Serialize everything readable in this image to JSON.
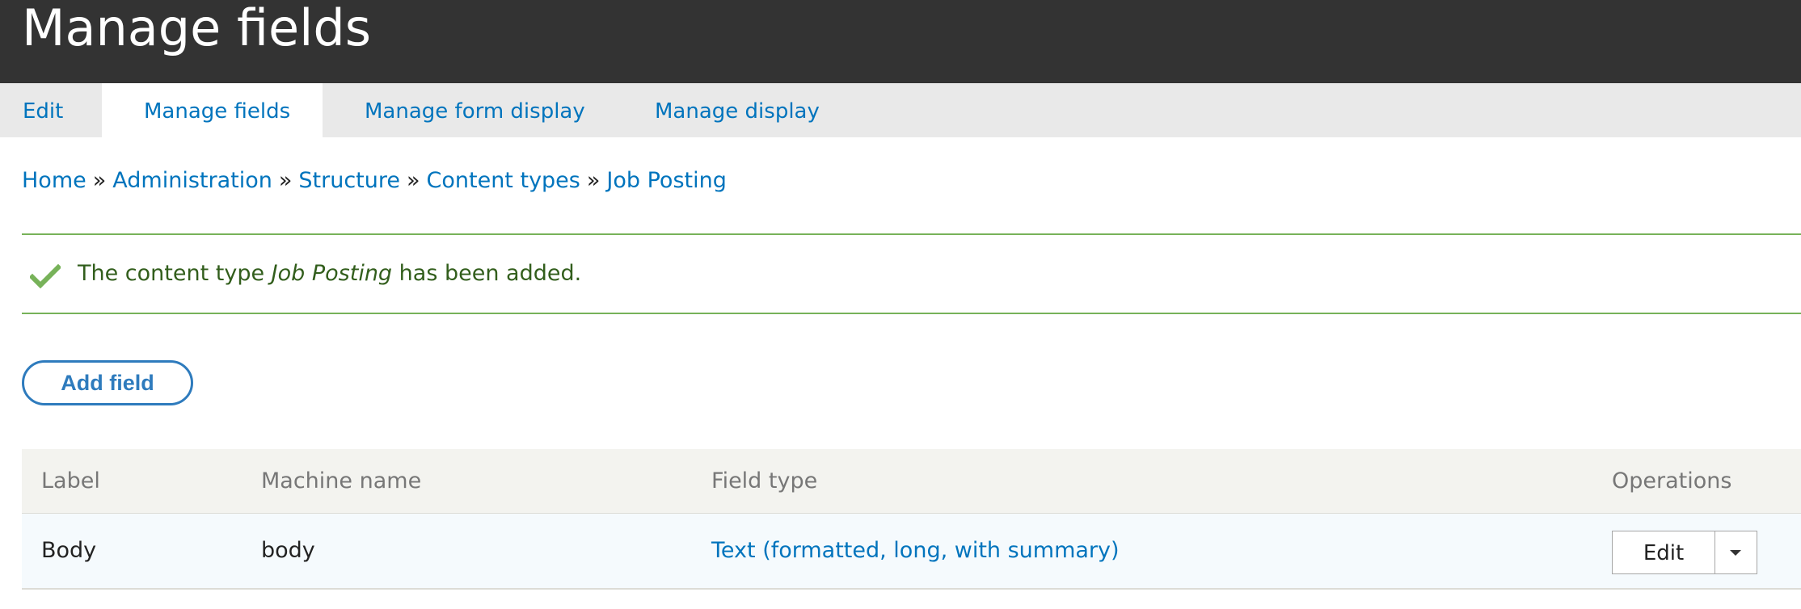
{
  "page": {
    "title": "Manage fields"
  },
  "tabs": [
    {
      "label": "Edit",
      "active": false
    },
    {
      "label": "Manage fields",
      "active": true
    },
    {
      "label": "Manage form display",
      "active": false
    },
    {
      "label": "Manage display",
      "active": false
    }
  ],
  "breadcrumb": {
    "items": [
      "Home",
      "Administration",
      "Structure",
      "Content types",
      "Job Posting"
    ],
    "separator": "»"
  },
  "message": {
    "prefix": "The content type ",
    "emphasis": "Job Posting",
    "suffix": " has been added.",
    "icon": "checkmark-icon",
    "color": "#77b259"
  },
  "actions": {
    "add_field_label": "Add field"
  },
  "table": {
    "headers": {
      "label": "Label",
      "machine_name": "Machine name",
      "field_type": "Field type",
      "operations": "Operations"
    },
    "rows": [
      {
        "label": "Body",
        "machine_name": "body",
        "field_type": "Text (formatted, long, with summary)",
        "operation_label": "Edit"
      }
    ]
  },
  "colors": {
    "header_bg": "#333333",
    "link": "#0074bd",
    "accent_button": "#2e7bbd"
  }
}
